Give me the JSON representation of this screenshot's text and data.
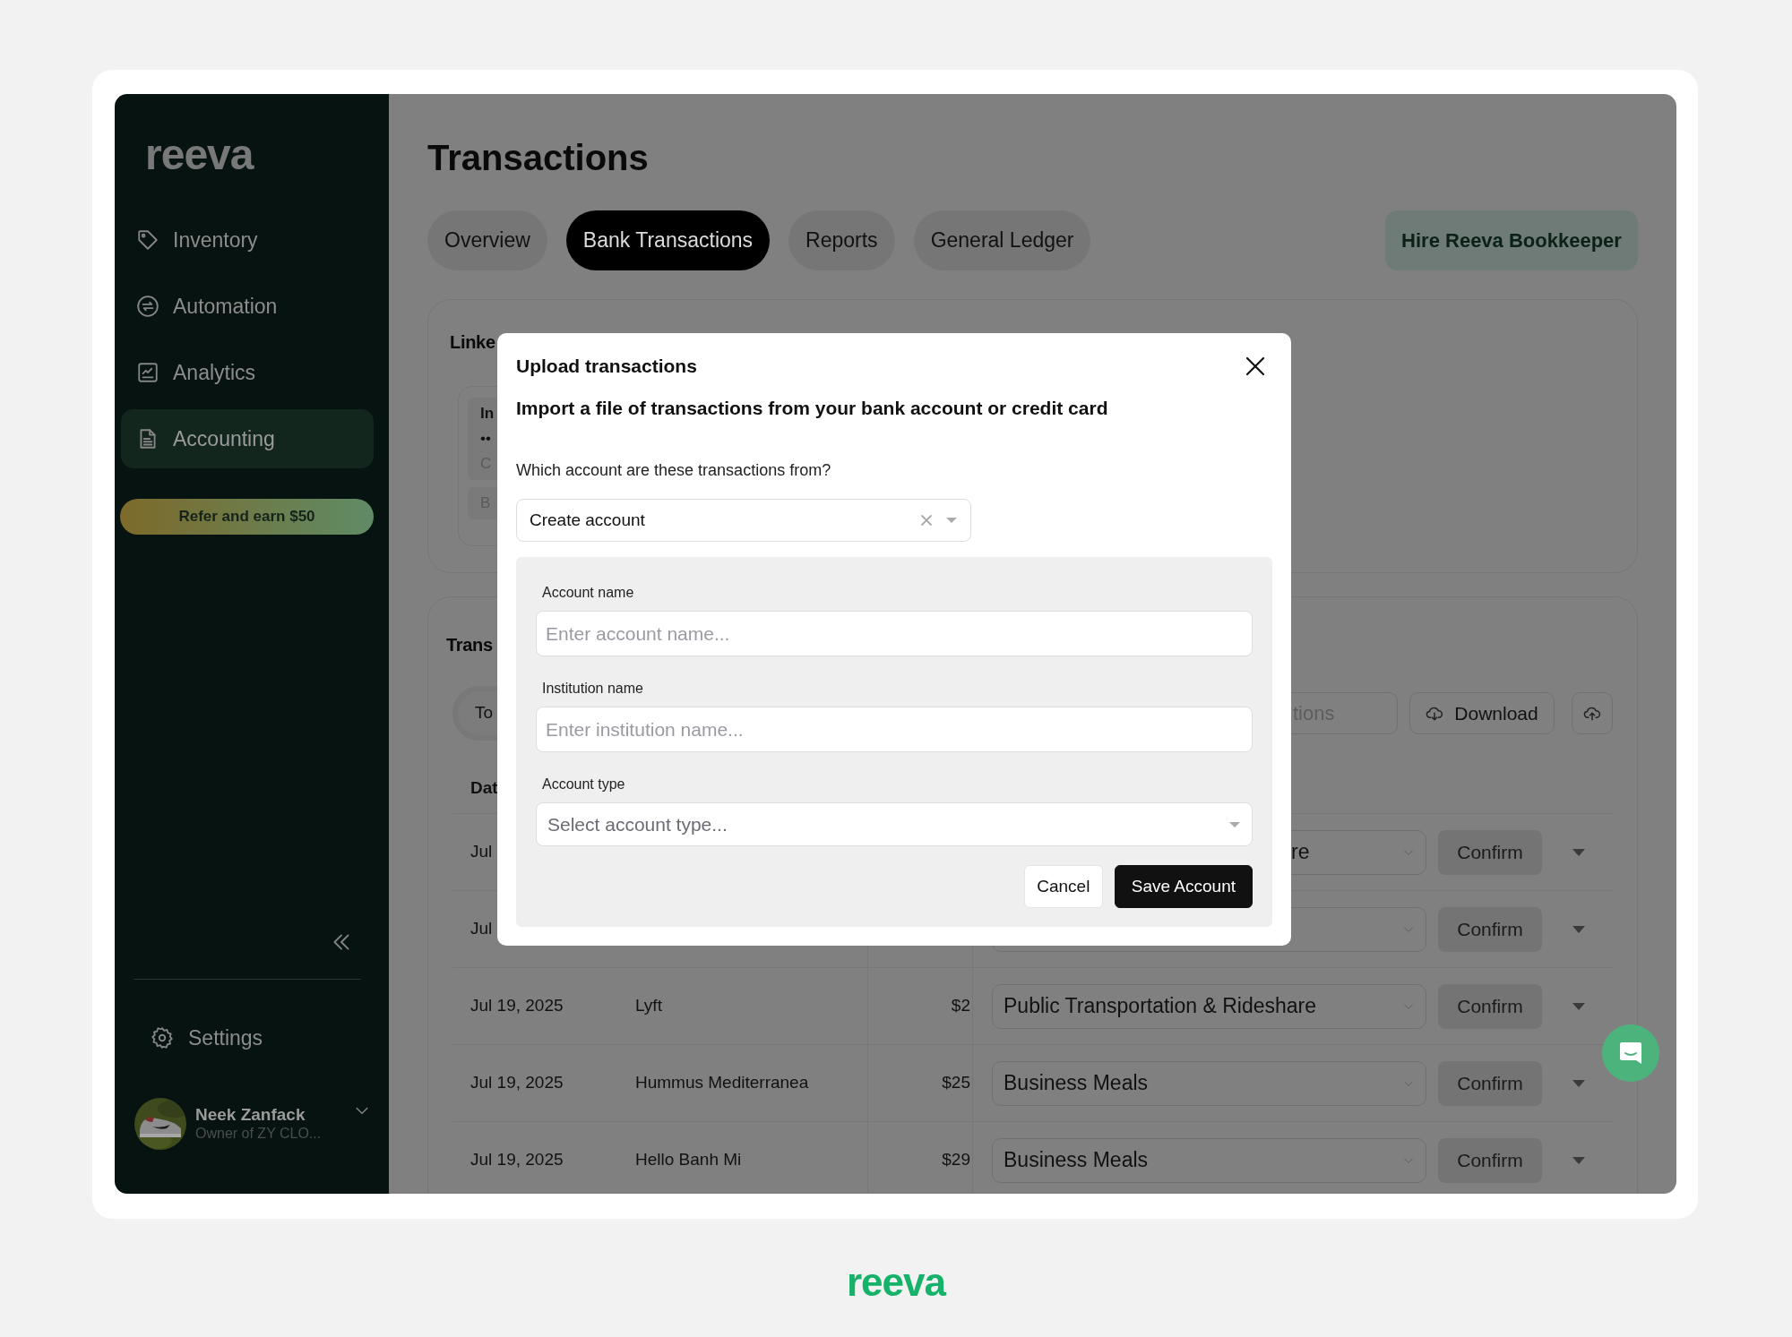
{
  "sidebar": {
    "logo": "reeva",
    "items": [
      {
        "label": "Inventory",
        "selected": false
      },
      {
        "label": "Automation",
        "selected": false
      },
      {
        "label": "Analytics",
        "selected": false
      },
      {
        "label": "Accounting",
        "selected": true
      }
    ],
    "promo_button": "Refer and earn $50",
    "settings": "Settings",
    "user": {
      "name": "Neek Zanfack",
      "subtitle": "Owner of ZY CLO..."
    }
  },
  "page": {
    "title": "Transactions",
    "tabs": [
      {
        "label": "Overview",
        "selected": false
      },
      {
        "label": "Bank Transactions",
        "selected": true
      },
      {
        "label": "Reports",
        "selected": false
      },
      {
        "label": "General Ledger",
        "selected": false
      }
    ],
    "hire_button": "Hire Reeva Bookkeeper"
  },
  "linked_card": {
    "title": "Linke",
    "lines": [
      "In",
      "••",
      "C",
      "B"
    ]
  },
  "transactions_card": {
    "title": "Trans",
    "toggle": "To",
    "search_field": "tions",
    "download_button": "Download",
    "columns": [
      "Dat"
    ],
    "rows": [
      {
        "date": "Jul",
        "category": "re",
        "action": "Confirm"
      },
      {
        "date": "Jul",
        "action": "Confirm"
      },
      {
        "date": "Jul 19, 2025",
        "description": "Lyft",
        "amount": "$2",
        "category": "Public Transportation & Rideshare",
        "action": "Confirm"
      },
      {
        "date": "Jul 19, 2025",
        "description": "Hummus Mediterranea",
        "amount": "$25",
        "category": "Business Meals",
        "action": "Confirm"
      },
      {
        "date": "Jul 19, 2025",
        "description": "Hello Banh Mi",
        "amount": "$29",
        "category": "Business Meals",
        "action": "Confirm"
      }
    ]
  },
  "modal": {
    "title": "Upload transactions",
    "subtitle": "Import a file of transactions from your bank account or credit card",
    "question": "Which account are these transactions from?",
    "account_select": "Create account",
    "fields": [
      {
        "label": "Account name",
        "placeholder": "Enter account name...",
        "kind": "input"
      },
      {
        "label": "Institution name",
        "placeholder": "Enter institution name...",
        "kind": "input"
      },
      {
        "label": "Account type",
        "placeholder": "Select account type...",
        "kind": "select"
      }
    ],
    "buttons": [
      {
        "label": "Cancel",
        "primary": false
      },
      {
        "label": "Save Account",
        "primary": true
      }
    ]
  },
  "footer": {
    "logo": "reeva"
  }
}
